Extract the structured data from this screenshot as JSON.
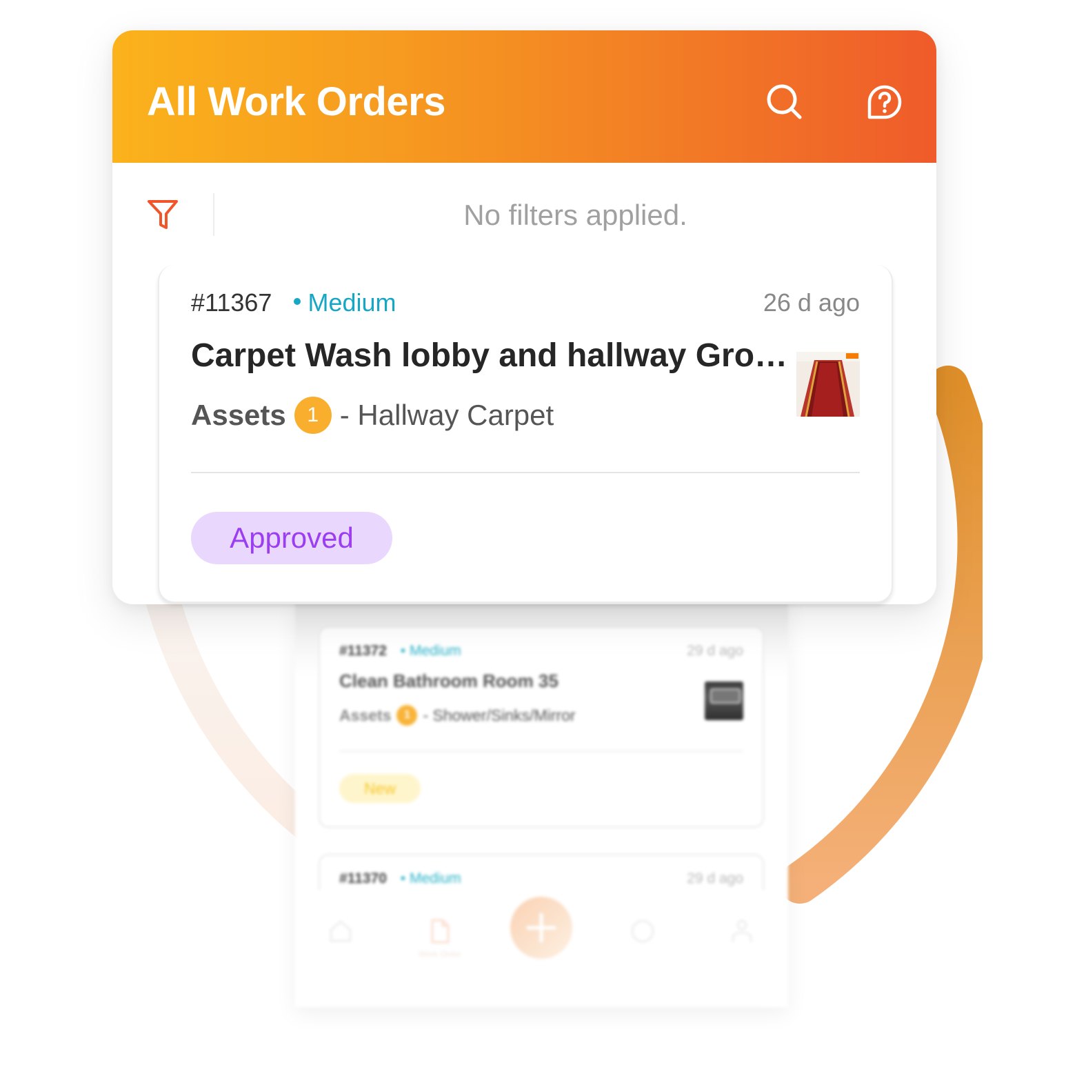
{
  "colors": {
    "header_gradient_start": "#fbb21b",
    "header_gradient_end": "#ef5b2a",
    "accent": "#ef5b2a",
    "priority_medium": "#17a7c4",
    "count_badge": "#f9ae2e",
    "status_approved_bg": "#ead7fe",
    "status_approved_text": "#9b3df0",
    "status_new_bg": "#fff5cc",
    "status_new_text": "#f5c92c"
  },
  "header": {
    "title": "All Work Orders",
    "search_icon": "search-icon",
    "help_icon": "help-chat-icon"
  },
  "filter_bar": {
    "icon": "filter-funnel-icon",
    "status_text": "No filters applied."
  },
  "work_orders": [
    {
      "id": "#11367",
      "priority": "Medium",
      "age": "26 d ago",
      "title": "Carpet Wash lobby and hallway Ground Floor",
      "title_display": "Carpet Wash lobby and hallway Groun...",
      "assets_label": "Assets",
      "asset_count": "1",
      "asset_name": "- Hallway Carpet",
      "thumbnail": "hallway-carpet-photo",
      "status": "Approved"
    },
    {
      "id": "#11372",
      "priority": "Medium",
      "age": "29 d ago",
      "title": "Clean Bathroom Room 35",
      "assets_label": "Assets",
      "asset_count": "1",
      "asset_name": "- Shower/Sinks/Mirror",
      "thumbnail": "bathroom-mirror-photo",
      "status": "New"
    },
    {
      "id": "#11370",
      "priority": "Medium",
      "age": "29 d ago"
    }
  ],
  "bottom_nav": {
    "items": [
      {
        "icon": "home-icon",
        "label": ""
      },
      {
        "icon": "document-icon",
        "label": "Work Order"
      },
      {
        "icon": "plus-icon",
        "label": ""
      },
      {
        "icon": "info-icon",
        "label": ""
      },
      {
        "icon": "user-icon",
        "label": ""
      }
    ]
  }
}
